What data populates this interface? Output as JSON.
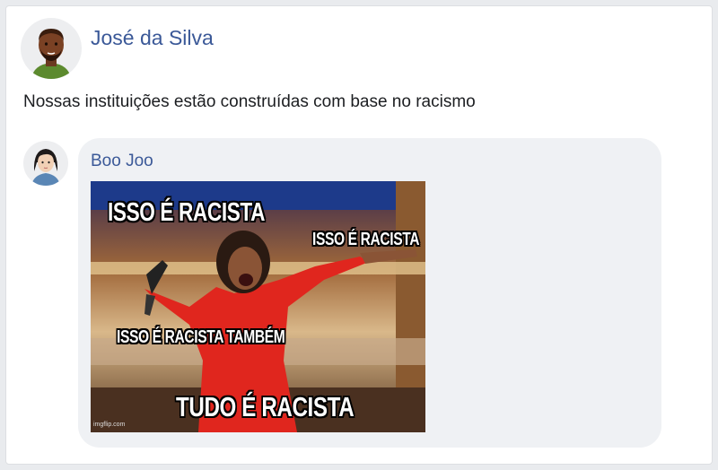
{
  "post": {
    "author": "José da Silva",
    "text": "Nossas instituições estão construídas com base no racismo"
  },
  "comment": {
    "author": "Boo Joo",
    "meme": {
      "captions": [
        "ISSO É RACISTA",
        "ISSO É RACISTA",
        "ISSO É RACISTA TAMBÉM",
        "TUDO É RACISTA"
      ],
      "watermark": "imgflip.com"
    }
  },
  "colors": {
    "link": "#3b5998",
    "bubble": "#eff1f4",
    "background": "#e9ebee"
  }
}
